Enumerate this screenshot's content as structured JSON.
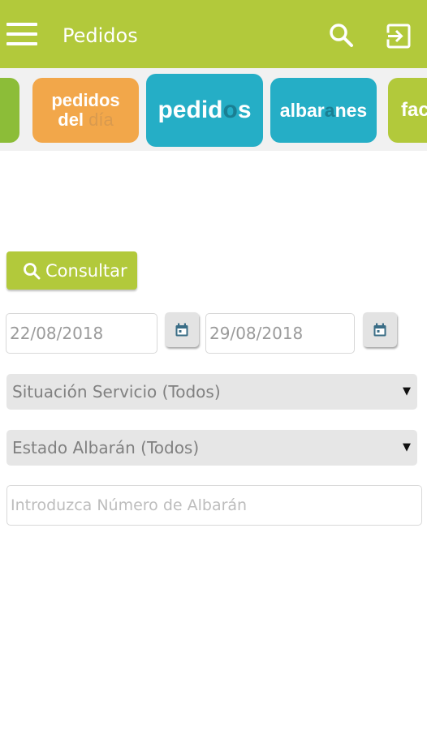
{
  "appbar": {
    "title": "Pedidos",
    "menu_icon": "hamburger-menu-icon",
    "search_icon": "search-icon",
    "logout_icon": "logout-icon",
    "color": "#b2c93b"
  },
  "tiles": {
    "pedidos_del_dia": {
      "line1": "pedidos",
      "line2_a": "del ",
      "line2_b": "día",
      "color": "#f2a74a"
    },
    "pedidos": {
      "part1": "pedid",
      "part2": "o",
      "part3": "s",
      "color": "#25aec6"
    },
    "albaranes": {
      "part1": "albar",
      "part2": "a",
      "part3": "nes",
      "color": "#25aec6"
    },
    "facturas": {
      "label": "fac",
      "color": "#b2c93b"
    }
  },
  "consultar": {
    "label": "Consultar",
    "icon": "search-icon"
  },
  "dates": {
    "from": "22/08/2018",
    "to": "29/08/2018",
    "calendar_icon": "calendar-icon"
  },
  "filters": {
    "situacion": "Situación Servicio (Todos)",
    "estado": "Estado Albarán (Todos)",
    "arrow": "▼"
  },
  "albaran_input": {
    "placeholder": "Introduzca Número de Albarán"
  }
}
